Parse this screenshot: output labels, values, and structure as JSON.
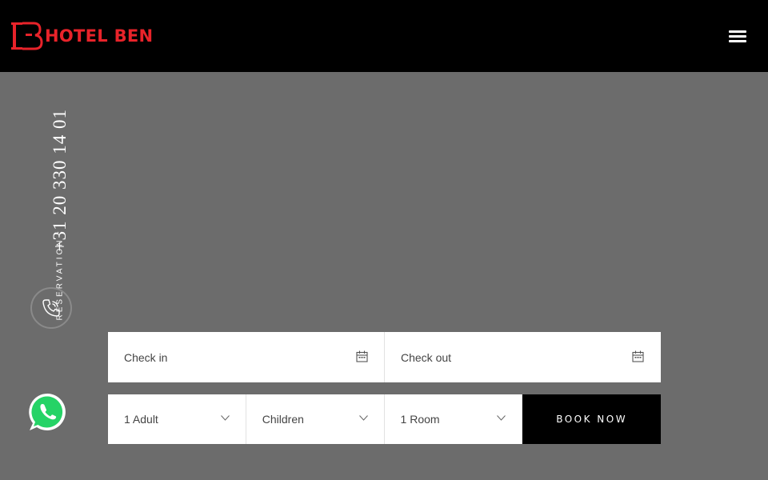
{
  "header": {
    "logo_text": "HOTEL BEN",
    "brand_color": "#e8232a"
  },
  "reservation": {
    "label": "RESERVATION :",
    "phone": "+31 20 330 14 01"
  },
  "icons": {
    "phone": "phone-call-icon",
    "whatsapp": "whatsapp-icon",
    "menu": "hamburger-menu-icon",
    "calendar": "calendar-icon",
    "chevron": "chevron-down-icon"
  },
  "booking": {
    "check_in": "Check in",
    "check_out": "Check out",
    "adults": "1 Adult",
    "children": "Children",
    "rooms": "1 Room",
    "submit": "BOOK NOW"
  }
}
